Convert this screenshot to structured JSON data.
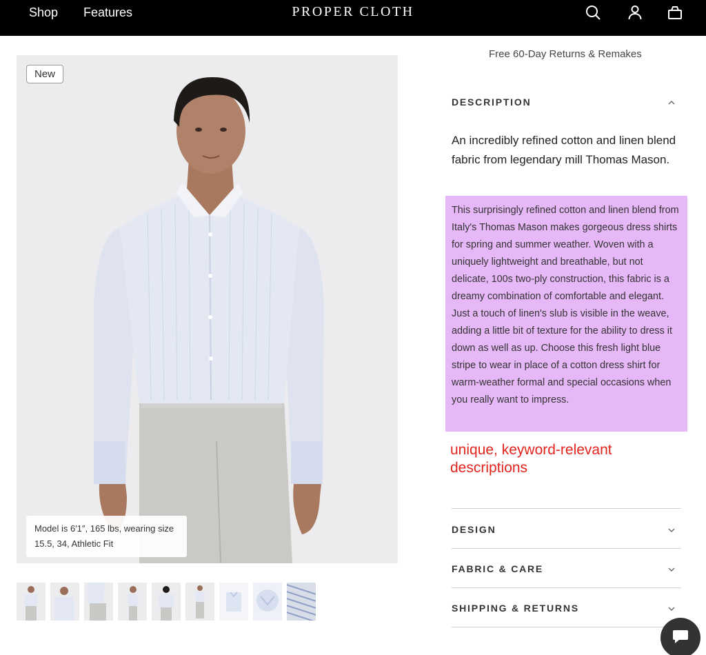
{
  "header": {
    "nav": [
      "Shop",
      "Features"
    ],
    "brand": "PROPER CLOTH",
    "icons": [
      "search-icon",
      "account-icon",
      "shopping-bag-icon"
    ]
  },
  "product_image": {
    "badge": "New",
    "model_note": "Model is 6′1″, 165 lbs, wearing size 15.5, 34, Athletic Fit",
    "thumbnail_count": 9
  },
  "info": {
    "returns_text": "Free 60-Day Returns & Remakes",
    "description": {
      "heading": "DESCRIPTION",
      "lead": "An incredibly refined cotton and linen blend fabric from legendary mill Thomas Mason.",
      "body": "This surprisingly refined cotton and linen blend from Italy's Thomas Mason makes gorgeous dress shirts for spring and summer weather. Woven with a uniquely lightweight and breathable, but not delicate, 100s two-ply construction, this fabric is a dreamy combination of comfortable and elegant. Just a touch of linen's slub is visible in the weave, adding a little bit of texture for the ability to dress it down as well as up. Choose this fresh light blue stripe to wear in place of a cotton dress shirt for warm-weather formal and special occasions when you really want to impress."
    },
    "annotation": "unique, keyword-relevant descriptions",
    "accordions": [
      "DESIGN",
      "FABRIC & CARE",
      "SHIPPING & RETURNS"
    ]
  },
  "colors": {
    "header_bg": "#000000",
    "highlight": "#e7b8f8",
    "annotation": "#e3231d",
    "chat_button": "#333333"
  }
}
